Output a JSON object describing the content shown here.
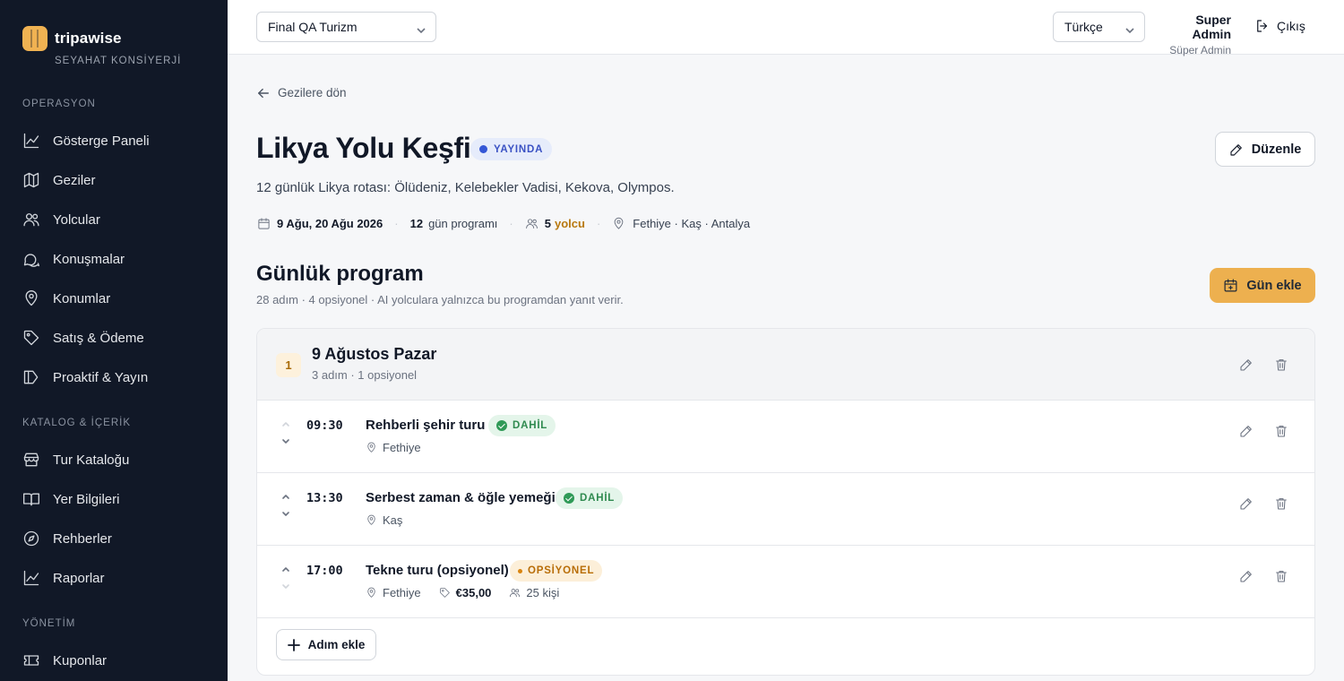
{
  "brand": {
    "name": "tripawise",
    "tagline": "SEYAHAT KONSİYERJİ"
  },
  "sidebar": {
    "sections": [
      {
        "label": "OPERASYON",
        "items": [
          {
            "label": "Gösterge Paneli",
            "icon": "chart-line-icon"
          },
          {
            "label": "Geziler",
            "icon": "map-icon"
          },
          {
            "label": "Yolcular",
            "icon": "users-icon"
          },
          {
            "label": "Konuşmalar",
            "icon": "chat-icon"
          },
          {
            "label": "Konumlar",
            "icon": "map-pin-icon"
          },
          {
            "label": "Satış & Ödeme",
            "icon": "tag-icon"
          },
          {
            "label": "Proaktif & Yayın",
            "icon": "megaphone-icon"
          }
        ]
      },
      {
        "label": "KATALOG & İÇERİK",
        "items": [
          {
            "label": "Tur Kataloğu",
            "icon": "store-icon"
          },
          {
            "label": "Yer Bilgileri",
            "icon": "book-icon"
          },
          {
            "label": "Rehberler",
            "icon": "compass-icon"
          },
          {
            "label": "Raporlar",
            "icon": "chart-line-icon"
          }
        ]
      },
      {
        "label": "YÖNETİM",
        "items": [
          {
            "label": "Kuponlar",
            "icon": "ticket-icon"
          }
        ]
      }
    ]
  },
  "topbar": {
    "company": "Final QA Turizm",
    "language": "Türkçe",
    "user_name": "Super Admin",
    "user_role": "Süper Admin",
    "logout_label": "Çıkış"
  },
  "trip": {
    "back_label": "Gezilere dön",
    "title": "Likya Yolu Keşfi",
    "status": "YAYINDA",
    "edit_label": "Düzenle",
    "description": "12 günlük Likya rotası: Ölüdeniz, Kelebekler Vadisi, Kekova, Olympos.",
    "dates": "9 Ağu, 20 Ağu 2026",
    "day_count": "12",
    "day_count_suffix": "gün programı",
    "passenger_count": "5",
    "passenger_suffix": "yolcu",
    "locations": "Fethiye · Kaş · Antalya"
  },
  "program": {
    "title": "Günlük program",
    "subtitle": "28 adım · 4 opsiyonel · AI yolculara yalnızca bu programdan yanıt verir.",
    "add_day_label": "Gün ekle",
    "day": {
      "number": "1",
      "title": "9 Ağustos Pazar",
      "subtitle": "3 adım · 1 opsiyonel",
      "steps": [
        {
          "time": "09:30",
          "title": "Rehberli şehir turu",
          "badge": "DAHİL",
          "location": "Fethiye",
          "price": "",
          "capacity": ""
        },
        {
          "time": "13:30",
          "title": "Serbest zaman & öğle yemeği",
          "badge": "DAHİL",
          "location": "Kaş",
          "price": "",
          "capacity": ""
        },
        {
          "time": "17:00",
          "title": "Tekne turu (opsiyonel)",
          "badge": "OPSİYONEL",
          "location": "Fethiye",
          "price": "€35,00",
          "capacity": "25 kişi"
        }
      ],
      "add_step_label": "Adım ekle"
    }
  },
  "colors": {
    "sidebar_bg": "#111827",
    "accent": "#edb04f",
    "status_blue": "#3557d6",
    "included_green": "#2f8a4f",
    "optional_orange": "#b86d07"
  }
}
